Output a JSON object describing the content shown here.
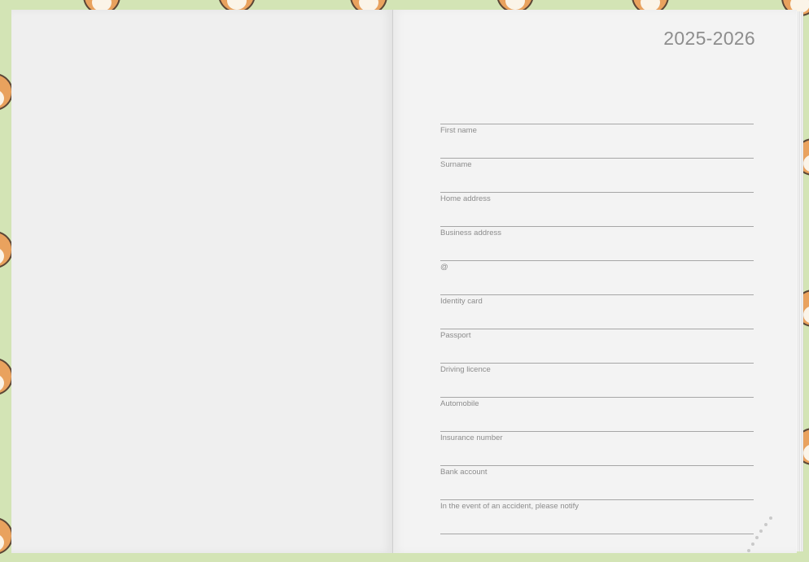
{
  "planner": {
    "year": "2025-2026",
    "fields": [
      {
        "label": "First name"
      },
      {
        "label": "Surname"
      },
      {
        "label": "Home address"
      },
      {
        "label": "Business address"
      },
      {
        "label": "@"
      },
      {
        "label": "Identity card"
      },
      {
        "label": "Passport"
      },
      {
        "label": "Driving licence"
      },
      {
        "label": "Automobile"
      },
      {
        "label": "Insurance number"
      },
      {
        "label": "Bank account"
      },
      {
        "label": "In the event of an accident, please notify"
      }
    ]
  },
  "colors": {
    "cover": "#d3e4b5",
    "page": "#f3f3f3",
    "text": "#8c8c8c",
    "dog": "#e9a25e"
  },
  "icons": [
    "shiba-dog-icon"
  ]
}
